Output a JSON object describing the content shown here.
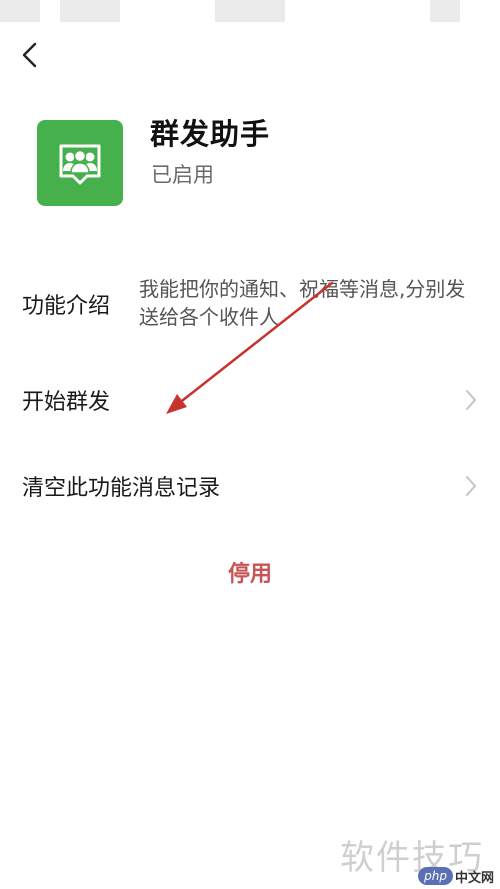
{
  "header": {
    "back_icon": "chevron-left-icon"
  },
  "app": {
    "icon": "group-people-icon",
    "icon_color": "#46b14c",
    "title": "群发助手",
    "status": "已启用"
  },
  "rows": {
    "intro": {
      "label": "功能介绍",
      "description": "我能把你的通知、祝福等消息,分别发送给各个收件人"
    },
    "start": {
      "label": "开始群发"
    },
    "clear": {
      "label": "清空此功能消息记录"
    }
  },
  "actions": {
    "disable_label": "停用",
    "disable_color": "#c95454"
  },
  "annotation": {
    "color": "#c8332f"
  },
  "watermark": {
    "text": "软件技巧",
    "site_logo": "php",
    "site_name": "中文网"
  }
}
